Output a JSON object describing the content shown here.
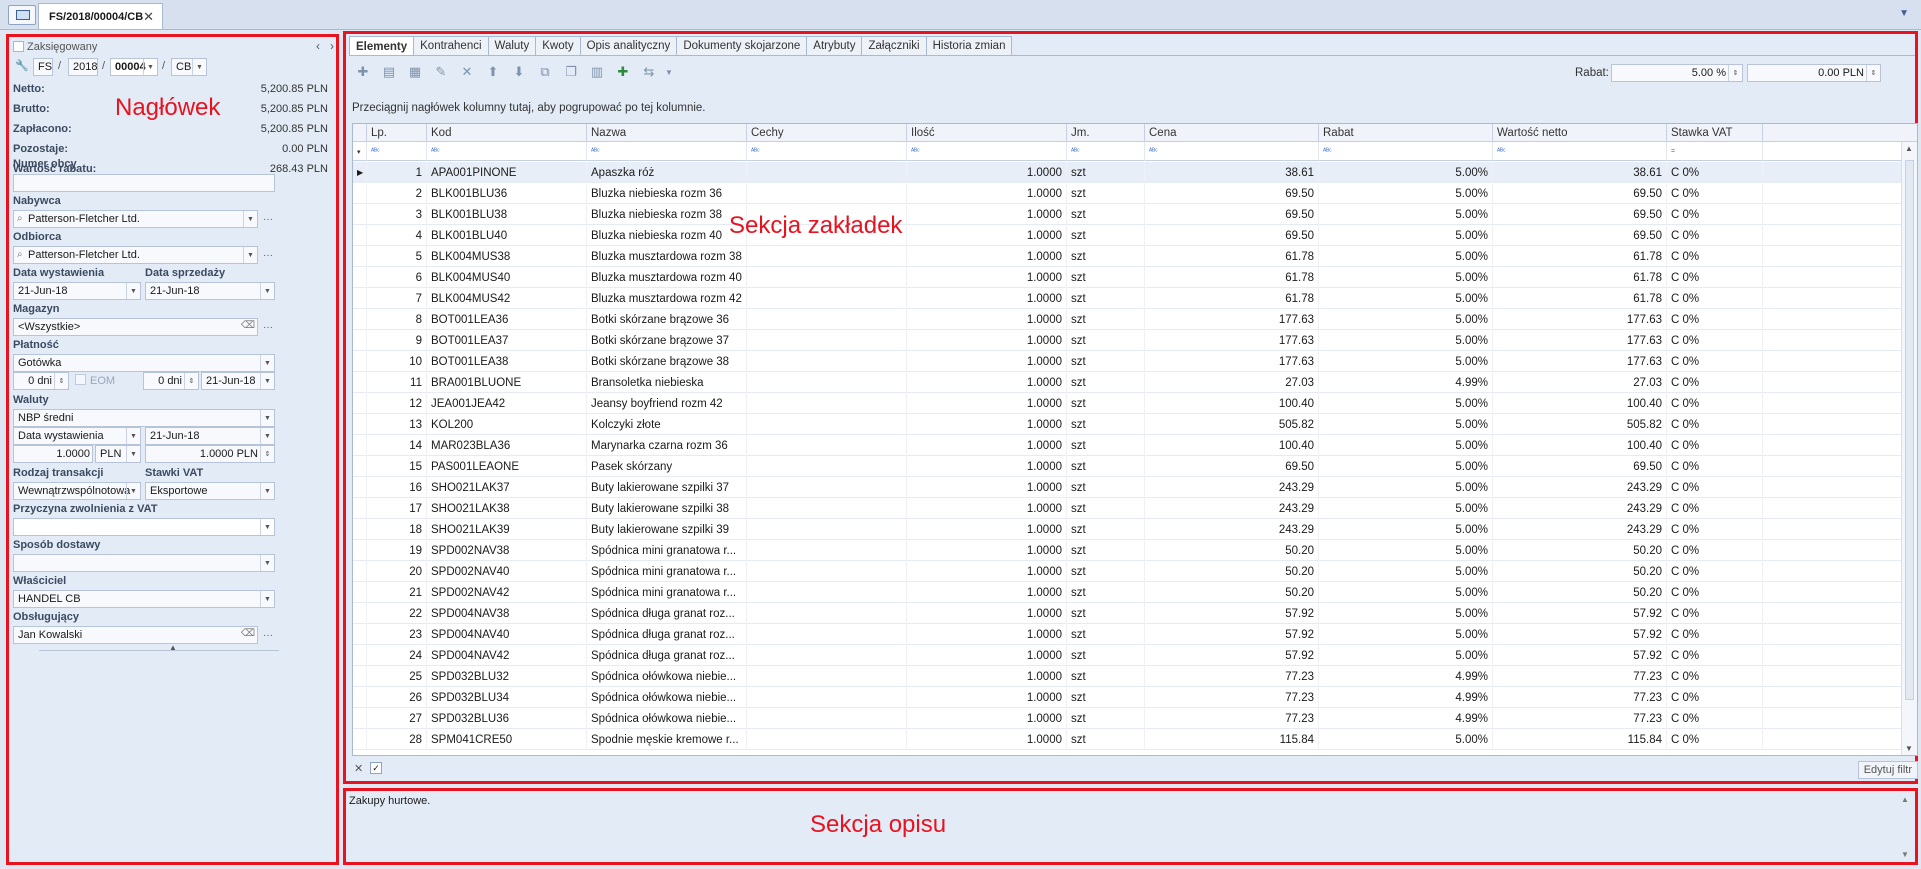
{
  "window": {
    "doc_tab": "FS/2018/00004/CB"
  },
  "header": {
    "label": "Nagłówek",
    "booked_label": "Zaksięgowany",
    "number": {
      "type": "FS",
      "year": "2018",
      "seq": "00004",
      "series": "CB"
    },
    "totals": [
      {
        "label": "Netto:",
        "value": "5,200.85 PLN"
      },
      {
        "label": "Brutto:",
        "value": "5,200.85 PLN"
      },
      {
        "label": "Zapłacono:",
        "value": "5,200.85 PLN"
      },
      {
        "label": "Pozostaje:",
        "value": "0.00 PLN"
      },
      {
        "label": "Wartość rabatu:",
        "value": "268.43 PLN"
      }
    ],
    "foreign_number_label": "Numer obcy",
    "buyer_label": "Nabywca",
    "buyer_value": "Patterson-Fletcher Ltd.",
    "recipient_label": "Odbiorca",
    "recipient_value": "Patterson-Fletcher Ltd.",
    "issue_date_label": "Data wystawienia",
    "issue_date_value": "21-Jun-18",
    "sale_date_label": "Data sprzedaży",
    "sale_date_value": "21-Jun-18",
    "warehouse_label": "Magazyn",
    "warehouse_value": "<Wszystkie>",
    "payment_label": "Płatność",
    "payment_value": "Gotówka",
    "days1": "0 dni",
    "eom_label": "EOM",
    "days2": "0 dni",
    "payment_date": "21-Jun-18",
    "currency_label": "Waluty",
    "currency_rate_type": "NBP średni",
    "currency_date_type": "Data wystawienia",
    "currency_date": "21-Jun-18",
    "rate_value": "1.0000",
    "rate_currency": "PLN",
    "rate_value2": "1.0000 PLN",
    "transaction_type_label": "Rodzaj transakcji",
    "transaction_type_value": "Wewnątrzwspólnotowa",
    "vat_rates_label": "Stawki VAT",
    "vat_rates_value": "Eksportowe",
    "vat_exempt_label": "Przyczyna zwolnienia z VAT",
    "delivery_label": "Sposób dostawy",
    "owner_label": "Właściciel",
    "owner_value": "HANDEL CB",
    "handler_label": "Obsługujący",
    "handler_value": "Jan Kowalski"
  },
  "tabs": {
    "section_label": "Sekcja zakładek",
    "items": [
      "Elementy",
      "Kontrahenci",
      "Waluty",
      "Kwoty",
      "Opis analityczny",
      "Dokumenty skojarzone",
      "Atrybuty",
      "Załączniki",
      "Historia zmian"
    ]
  },
  "toolbar": {
    "rabat_label": "Rabat:",
    "rabat_percent": "5.00 %",
    "rabat_amount": "0.00 PLN"
  },
  "grid": {
    "group_hint": "Przeciągnij nagłówek kolumny tutaj, aby pogrupować po tej kolumnie.",
    "columns": [
      "Lp.",
      "Kod",
      "Nazwa",
      "Cechy",
      "Ilość",
      "Jm.",
      "Cena",
      "Rabat",
      "Wartość netto",
      "Stawka VAT"
    ],
    "filter_glyph": "ᴬᴮᶜ",
    "vat_filter_glyph": "=",
    "rows": [
      [
        "1",
        "APA001PINONE",
        "Apaszka róż",
        "",
        "1.0000",
        "szt",
        "38.61",
        "5.00%",
        "38.61",
        "C 0%"
      ],
      [
        "2",
        "BLK001BLU36",
        "Bluzka niebieska rozm 36",
        "",
        "1.0000",
        "szt",
        "69.50",
        "5.00%",
        "69.50",
        "C 0%"
      ],
      [
        "3",
        "BLK001BLU38",
        "Bluzka niebieska rozm 38",
        "",
        "1.0000",
        "szt",
        "69.50",
        "5.00%",
        "69.50",
        "C 0%"
      ],
      [
        "4",
        "BLK001BLU40",
        "Bluzka niebieska rozm 40",
        "",
        "1.0000",
        "szt",
        "69.50",
        "5.00%",
        "69.50",
        "C 0%"
      ],
      [
        "5",
        "BLK004MUS38",
        "Bluzka musztardowa rozm 38",
        "",
        "1.0000",
        "szt",
        "61.78",
        "5.00%",
        "61.78",
        "C 0%"
      ],
      [
        "6",
        "BLK004MUS40",
        "Bluzka musztardowa rozm 40",
        "",
        "1.0000",
        "szt",
        "61.78",
        "5.00%",
        "61.78",
        "C 0%"
      ],
      [
        "7",
        "BLK004MUS42",
        "Bluzka musztardowa rozm 42",
        "",
        "1.0000",
        "szt",
        "61.78",
        "5.00%",
        "61.78",
        "C 0%"
      ],
      [
        "8",
        "BOT001LEA36",
        "Botki skórzane brązowe 36",
        "",
        "1.0000",
        "szt",
        "177.63",
        "5.00%",
        "177.63",
        "C 0%"
      ],
      [
        "9",
        "BOT001LEA37",
        "Botki skórzane brązowe 37",
        "",
        "1.0000",
        "szt",
        "177.63",
        "5.00%",
        "177.63",
        "C 0%"
      ],
      [
        "10",
        "BOT001LEA38",
        "Botki skórzane brązowe 38",
        "",
        "1.0000",
        "szt",
        "177.63",
        "5.00%",
        "177.63",
        "C 0%"
      ],
      [
        "11",
        "BRA001BLUONE",
        "Bransoletka niebieska",
        "",
        "1.0000",
        "szt",
        "27.03",
        "4.99%",
        "27.03",
        "C 0%"
      ],
      [
        "12",
        "JEA001JEA42",
        "Jeansy boyfriend rozm 42",
        "",
        "1.0000",
        "szt",
        "100.40",
        "5.00%",
        "100.40",
        "C 0%"
      ],
      [
        "13",
        "KOL200",
        "Kolczyki złote",
        "",
        "1.0000",
        "szt",
        "505.82",
        "5.00%",
        "505.82",
        "C 0%"
      ],
      [
        "14",
        "MAR023BLA36",
        "Marynarka czarna rozm 36",
        "",
        "1.0000",
        "szt",
        "100.40",
        "5.00%",
        "100.40",
        "C 0%"
      ],
      [
        "15",
        "PAS001LEAONE",
        "Pasek skórzany",
        "",
        "1.0000",
        "szt",
        "69.50",
        "5.00%",
        "69.50",
        "C 0%"
      ],
      [
        "16",
        "SHO021LAK37",
        "Buty lakierowane szpilki 37",
        "",
        "1.0000",
        "szt",
        "243.29",
        "5.00%",
        "243.29",
        "C 0%"
      ],
      [
        "17",
        "SHO021LAK38",
        "Buty lakierowane szpilki 38",
        "",
        "1.0000",
        "szt",
        "243.29",
        "5.00%",
        "243.29",
        "C 0%"
      ],
      [
        "18",
        "SHO021LAK39",
        "Buty lakierowane szpilki 39",
        "",
        "1.0000",
        "szt",
        "243.29",
        "5.00%",
        "243.29",
        "C 0%"
      ],
      [
        "19",
        "SPD002NAV38",
        "Spódnica mini granatowa r...",
        "",
        "1.0000",
        "szt",
        "50.20",
        "5.00%",
        "50.20",
        "C 0%"
      ],
      [
        "20",
        "SPD002NAV40",
        "Spódnica mini granatowa r...",
        "",
        "1.0000",
        "szt",
        "50.20",
        "5.00%",
        "50.20",
        "C 0%"
      ],
      [
        "21",
        "SPD002NAV42",
        "Spódnica mini granatowa r...",
        "",
        "1.0000",
        "szt",
        "50.20",
        "5.00%",
        "50.20",
        "C 0%"
      ],
      [
        "22",
        "SPD004NAV38",
        "Spódnica długa granat roz...",
        "",
        "1.0000",
        "szt",
        "57.92",
        "5.00%",
        "57.92",
        "C 0%"
      ],
      [
        "23",
        "SPD004NAV40",
        "Spódnica długa granat roz...",
        "",
        "1.0000",
        "szt",
        "57.92",
        "5.00%",
        "57.92",
        "C 0%"
      ],
      [
        "24",
        "SPD004NAV42",
        "Spódnica długa granat roz...",
        "",
        "1.0000",
        "szt",
        "57.92",
        "5.00%",
        "57.92",
        "C 0%"
      ],
      [
        "25",
        "SPD032BLU32",
        "Spódnica ołówkowa niebie...",
        "",
        "1.0000",
        "szt",
        "77.23",
        "4.99%",
        "77.23",
        "C 0%"
      ],
      [
        "26",
        "SPD032BLU34",
        "Spódnica ołówkowa niebie...",
        "",
        "1.0000",
        "szt",
        "77.23",
        "4.99%",
        "77.23",
        "C 0%"
      ],
      [
        "27",
        "SPD032BLU36",
        "Spódnica ołówkowa niebie...",
        "",
        "1.0000",
        "szt",
        "77.23",
        "4.99%",
        "77.23",
        "C 0%"
      ],
      [
        "28",
        "SPM041CRE50",
        "Spodnie męskie kremowe r...",
        "",
        "1.0000",
        "szt",
        "115.84",
        "5.00%",
        "115.84",
        "C 0%"
      ]
    ],
    "edit_filter_label": "Edytuj filtr"
  },
  "description": {
    "section_label": "Sekcja opisu",
    "text": "Zakupy hurtowe."
  },
  "colors": {
    "annotation": "#e8131f",
    "panel": "#e3ebf6",
    "accent": "#3d6cc0"
  }
}
